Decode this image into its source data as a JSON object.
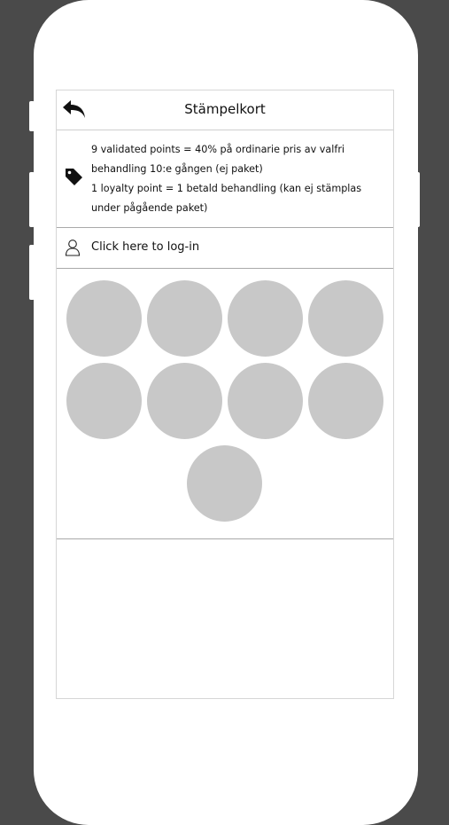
{
  "header": {
    "title": "Stämpelkort",
    "back_icon": "back-arrow-icon"
  },
  "info": {
    "icon": "tag-icon",
    "line1": "9 validated points = 40% på ordinarie pris av valfri behandling 10:e gången (ej paket)",
    "line2": "1 loyalty point = 1 betald behandling (kan ej stämplas under pågående paket)"
  },
  "login": {
    "icon": "user-icon",
    "label": "Click here to log-in"
  },
  "stamps": {
    "count": 9,
    "filled": 0,
    "color": "#c8c8c8"
  },
  "colors": {
    "background": "#4a4a4a",
    "device": "#ffffff"
  }
}
